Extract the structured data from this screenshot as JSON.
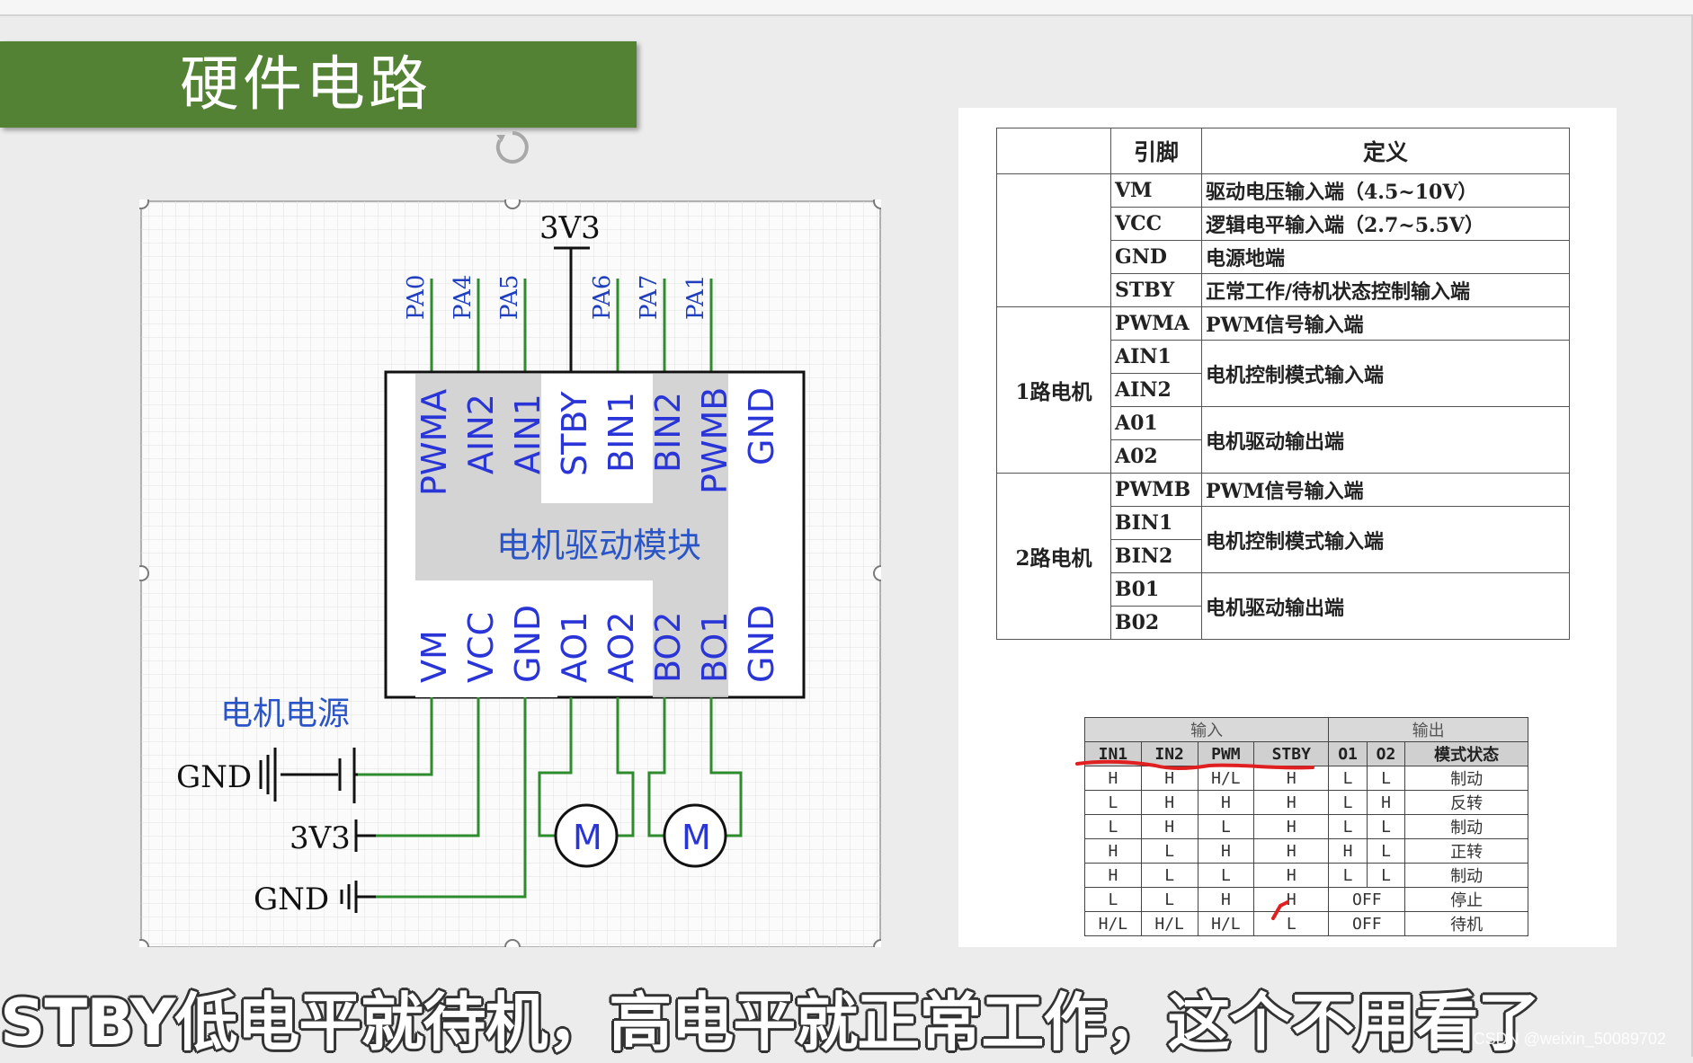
{
  "slide": {
    "title": "硬件电路",
    "subtitle": "STBY低电平就待机，高电平就正常工作，这个不用看了",
    "watermark": "CSDN @weixin_50089702"
  },
  "schematic": {
    "supply_label": "3V3",
    "module_label": "电机驱动模块",
    "motor_power_label": "电机电源",
    "top_gpio": [
      "PA0",
      "PA4",
      "PA5",
      "PA6",
      "PA7",
      "PA1"
    ],
    "top_pins": [
      "PWMA",
      "AIN2",
      "AIN1",
      "STBY",
      "BIN1",
      "BIN2",
      "PWMB",
      "GND"
    ],
    "bottom_pins": [
      "VM",
      "VCC",
      "GND",
      "AO1",
      "AO2",
      "BO2",
      "BO1",
      "GND"
    ],
    "left_labels": [
      "GND",
      "3V3",
      "GND"
    ],
    "motor_symbol": "M"
  },
  "pin_table": {
    "headers": [
      "",
      "引脚",
      "定义"
    ],
    "group1": "1路电机",
    "group2": "2路电机",
    "rows": [
      {
        "pin": "VM",
        "def": "驱动电压输入端（4.5~10V）"
      },
      {
        "pin": "VCC",
        "def": "逻辑电平输入端（2.7~5.5V）"
      },
      {
        "pin": "GND",
        "def": "电源地端"
      },
      {
        "pin": "STBY",
        "def": "正常工作/待机状态控制输入端"
      },
      {
        "pin": "PWMA",
        "def": "PWM信号输入端"
      },
      {
        "pin": "AIN1",
        "def": "电机控制模式输入端"
      },
      {
        "pin": "AIN2",
        "def": ""
      },
      {
        "pin": "A01",
        "def": "电机驱动输出端"
      },
      {
        "pin": "A02",
        "def": ""
      },
      {
        "pin": "PWMB",
        "def": "PWM信号输入端"
      },
      {
        "pin": "BIN1",
        "def": "电机控制模式输入端"
      },
      {
        "pin": "BIN2",
        "def": ""
      },
      {
        "pin": "B01",
        "def": "电机驱动输出端"
      },
      {
        "pin": "B02",
        "def": ""
      }
    ]
  },
  "truth_table": {
    "input_header": "输入",
    "output_header": "输出",
    "columns": [
      "IN1",
      "IN2",
      "PWM",
      "STBY",
      "O1",
      "O2",
      "模式状态"
    ],
    "rows": [
      [
        "H",
        "H",
        "H/L",
        "H",
        "L",
        "L",
        "制动"
      ],
      [
        "L",
        "H",
        "H",
        "H",
        "L",
        "H",
        "反转"
      ],
      [
        "L",
        "H",
        "L",
        "H",
        "L",
        "L",
        "制动"
      ],
      [
        "H",
        "L",
        "H",
        "H",
        "H",
        "L",
        "正转"
      ],
      [
        "H",
        "L",
        "L",
        "H",
        "L",
        "L",
        "制动"
      ],
      [
        "L",
        "L",
        "H",
        "H",
        "OFF",
        "",
        "停止"
      ],
      [
        "H/L",
        "H/L",
        "H/L",
        "L",
        "OFF",
        "",
        "待机"
      ]
    ]
  }
}
